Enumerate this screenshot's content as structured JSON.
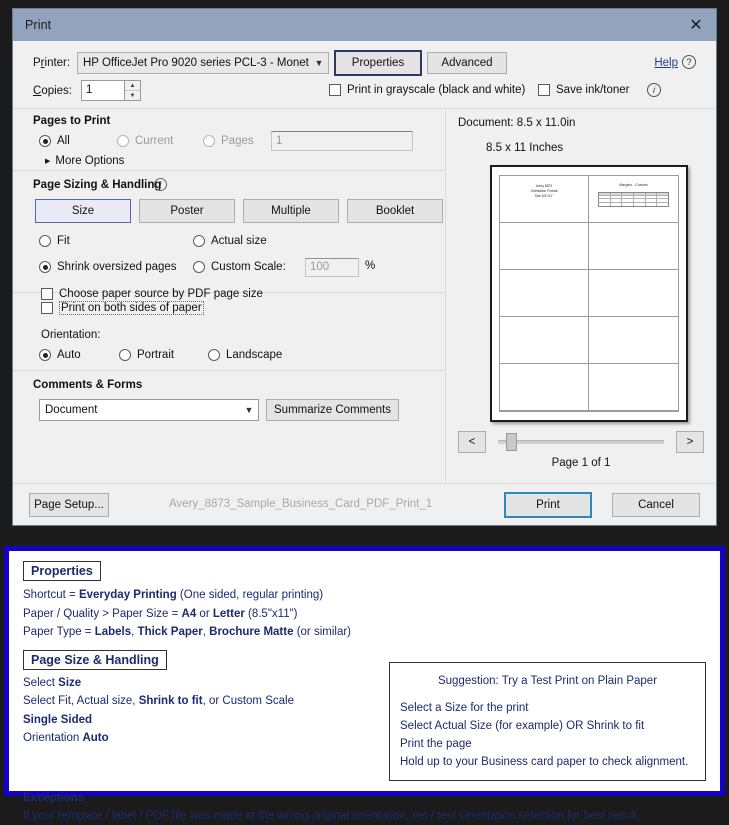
{
  "dialog": {
    "title": "Print",
    "close_icon": "close-icon",
    "printer": {
      "label": "Printer:",
      "value": "HP OfficeJet Pro 9020 series PCL-3 - Monet",
      "dropdown_icon": "chevron-down-icon",
      "properties_button": "Properties",
      "advanced_button": "Advanced",
      "help_link": "Help",
      "help_icon": "question-circle-icon"
    },
    "copies": {
      "label": "Copies:",
      "value": "1",
      "spinner_up": "▲",
      "spinner_down": "▼"
    },
    "grayscale_checkbox": "Print in grayscale (black and white)",
    "save_ink_checkbox": "Save ink/toner",
    "info_icon": "info-circle-icon",
    "pages_to_print": {
      "title": "Pages to Print",
      "all": "All",
      "current": "Current",
      "pages": "Pages",
      "pages_value": "1",
      "more_options": "More Options",
      "selected": "All"
    },
    "page_sizing": {
      "title": "Page Sizing & Handling",
      "info_icon": "info-circle-icon",
      "modes": [
        "Size",
        "Poster",
        "Multiple",
        "Booklet"
      ],
      "selected_mode": "Size",
      "fit": "Fit",
      "actual_size": "Actual size",
      "shrink": "Shrink oversized pages",
      "custom_scale": "Custom Scale:",
      "scale_value": "100",
      "percent": "%",
      "paper_source_checkbox": "Choose paper source by PDF page size",
      "selected_scaling": "Shrink oversized pages"
    },
    "duplex": {
      "both_sides_checkbox": "Print on both sides of paper",
      "orientation_label": "Orientation:",
      "auto": "Auto",
      "portrait": "Portrait",
      "landscape": "Landscape",
      "selected_orientation": "Auto"
    },
    "comments": {
      "title": "Comments & Forms",
      "value": "Document",
      "dropdown_icon": "chevron-down-icon",
      "summarize_button": "Summarize Comments"
    },
    "preview": {
      "document_size": "Document: 8.5 x 11.0in",
      "paper_size": "8.5 x 11 Inches",
      "card1_line1": "Avery 8873",
      "card1_line2": "Orientation Portrait",
      "card1_line3": "Size 8.5\"x11\"",
      "card2_title": "Margins - Custom",
      "prev_button": "<",
      "next_button": ">",
      "page_of": "Page 1 of 1"
    },
    "footer": {
      "page_setup_button": "Page Setup...",
      "file_name": "Avery_8873_Sample_Business_Card_PDF_Print_1",
      "print_button": "Print",
      "cancel_button": "Cancel"
    }
  },
  "notes": {
    "properties_header": "Properties",
    "properties_lines": [
      {
        "pre": "Shortcut = ",
        "bold": "Everyday Printing",
        "post": " (One sided, regular printing)"
      },
      {
        "pre": "Paper / Quality > Paper Size = ",
        "bold": "A4",
        "mid": " or ",
        "bold2": "Letter",
        "post": " (8.5\"x11\")"
      },
      {
        "pre": "Paper Type = ",
        "bold": "Labels",
        "mid": ", ",
        "bold2": "Thick Paper",
        "mid2": ", ",
        "bold3": "Brochure Matte",
        "post": " (or similar)"
      }
    ],
    "sizing_header": "Page Size & Handling",
    "sizing_lines": [
      {
        "pre": "Select ",
        "bold": "Size",
        "post": ""
      },
      {
        "pre": "Select Fit, Actual size, ",
        "bold": "Shrink to fit",
        "post": ", or Custom Scale"
      },
      {
        "pre": "",
        "bold": "Single Sided",
        "post": ""
      },
      {
        "pre": "Orientation ",
        "bold": "Auto",
        "post": ""
      }
    ],
    "suggestion_title": "Suggestion:  Try a Test Print on Plain Paper",
    "suggestion_lines": [
      "Select a Size for the print",
      "Select Actual Size (for example) OR Shrink to fit",
      "Print the page",
      "Hold up to your Business card paper to check alignment."
    ],
    "exceptions_header": "Exceptions",
    "exceptions_text": "If your template / label / PDF file was made at the wrong original orientation, set / test Orientation selection for best result."
  }
}
